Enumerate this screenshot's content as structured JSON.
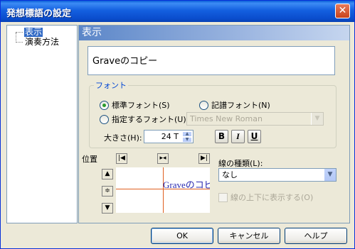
{
  "window": {
    "title": "発想標語の設定",
    "close": "✕"
  },
  "tree": {
    "items": [
      {
        "label": "表示",
        "selected": true
      },
      {
        "label": "演奏方法",
        "selected": false
      }
    ]
  },
  "panel": {
    "header": "表示",
    "display_text": "Graveのコピー",
    "font_group": {
      "legend": "フォント",
      "standard_font": "標準フォント(S)",
      "notation_font": "記譜フォント(N)",
      "specified_font": "指定するフォント(U)",
      "font_name": "Times New Roman",
      "size_label": "大きさ(H):",
      "size_value": "24 T",
      "bold": "B",
      "italic": "I",
      "underline": "U"
    },
    "position": {
      "label": "位置",
      "preview_text": "Graveのコピー",
      "buttons": {
        "left": "|◀",
        "center_h": "▸◂",
        "right": "▶|",
        "top": "▲",
        "middle_v": "≑",
        "bottom": "▼"
      }
    },
    "line_type": {
      "label": "線の種類(L):",
      "value": "なし"
    },
    "show_above_below": "線の上下に表示する(O)"
  },
  "buttons": {
    "ok": "OK",
    "cancel": "キャンセル",
    "help": "ヘルプ"
  },
  "colors": {
    "title_bar": "#0a4ccc",
    "selection": "#316ac5",
    "guide_lines": "#e06020",
    "preview_text": "#2a2ab0"
  }
}
